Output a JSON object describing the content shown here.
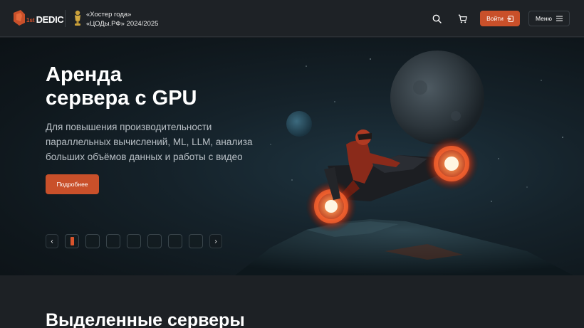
{
  "header": {
    "logo_prefix": "1st",
    "logo_text": "DEDIC",
    "award_line1": "«Хостер года»",
    "award_line2": "«ЦОДы.РФ» 2024/2025",
    "login_label": "Войти",
    "menu_label": "Меню"
  },
  "hero": {
    "title_line1": "Аренда",
    "title_line2": "сервера с GPU",
    "description": "Для повышения производительности параллельных вычислений, ML, LLM, анализа больших объёмов данных и работы с видео",
    "cta_label": "Подробнее",
    "prev_symbol": "‹",
    "next_symbol": "›",
    "slides_count": 7,
    "active_slide": 1
  },
  "section": {
    "title": "Выделенные серверы"
  },
  "colors": {
    "accent": "#c9502a",
    "background": "#1d2125",
    "hero_bg": "#15222a"
  },
  "icons": [
    "logo-icon",
    "award-icon",
    "search-icon",
    "cart-icon",
    "login-icon",
    "menu-icon",
    "chevron-left-icon",
    "chevron-right-icon"
  ]
}
